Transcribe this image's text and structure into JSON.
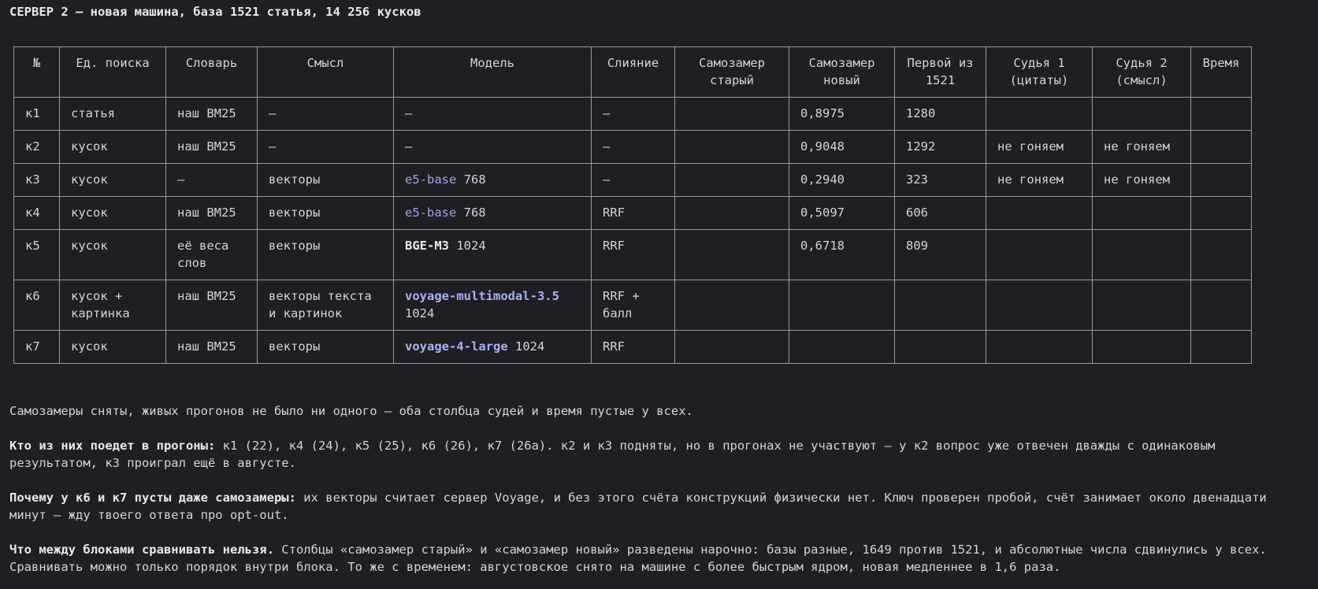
{
  "heading": "СЕРВЕР 2 — новая машина, база 1521 статья, 14 256 кусков",
  "table": {
    "headers": {
      "num": "№",
      "unit": "Ед. поиска",
      "dict": "Словарь",
      "sense": "Смысл",
      "model": "Модель",
      "fusion": "Слияние",
      "self_old": "Самозамер старый",
      "self_new": "Самозамер новый",
      "first": "Первой из 1521",
      "judge1": "Судья 1 (цитаты)",
      "judge2": "Судья 2 (смысл)",
      "time": "Время"
    },
    "rows": [
      {
        "num": "к1",
        "unit": "статья",
        "dict": "наш BM25",
        "sense": "—",
        "model_name": "—",
        "model_dim": "",
        "fusion": "—",
        "self_old": "",
        "self_new": "0,8975",
        "first": "1280",
        "judge1": "",
        "judge2": "",
        "time": ""
      },
      {
        "num": "к2",
        "unit": "кусок",
        "dict": "наш BM25",
        "sense": "—",
        "model_name": "—",
        "model_dim": "",
        "fusion": "—",
        "self_old": "",
        "self_new": "0,9048",
        "first": "1292",
        "judge1": "не гоняем",
        "judge2": "не гоняем",
        "time": ""
      },
      {
        "num": "к3",
        "unit": "кусок",
        "dict": "—",
        "sense": "векторы",
        "model_name": "e5-base",
        "model_dim": "768",
        "fusion": "—",
        "self_old": "",
        "self_new": "0,2940",
        "first": "323",
        "judge1": "не гоняем",
        "judge2": "не гоняем",
        "time": ""
      },
      {
        "num": "к4",
        "unit": "кусок",
        "dict": "наш BM25",
        "sense": "векторы",
        "model_name": "e5-base",
        "model_dim": "768",
        "fusion": "RRF",
        "self_old": "",
        "self_new": "0,5097",
        "first": "606",
        "judge1": "",
        "judge2": "",
        "time": ""
      },
      {
        "num": "к5",
        "unit": "кусок",
        "dict": "её веса слов",
        "sense": "векторы",
        "model_name": "BGE-M3",
        "model_dim": "1024",
        "fusion": "RRF",
        "self_old": "",
        "self_new": "0,6718",
        "first": "809",
        "judge1": "",
        "judge2": "",
        "time": ""
      },
      {
        "num": "к6",
        "unit": "кусок + картинка",
        "dict": "наш BM25",
        "sense": "векторы текста и картинок",
        "model_name": "voyage-multimodal-3.5",
        "model_dim": "1024",
        "fusion": "RRF + балл",
        "self_old": "",
        "self_new": "",
        "first": "",
        "judge1": "",
        "judge2": "",
        "time": ""
      },
      {
        "num": "к7",
        "unit": "кусок",
        "dict": "наш BM25",
        "sense": "векторы",
        "model_name": "voyage-4-large",
        "model_dim": "1024",
        "fusion": "RRF",
        "self_old": "",
        "self_new": "",
        "first": "",
        "judge1": "",
        "judge2": "",
        "time": ""
      }
    ]
  },
  "notes": {
    "p1": "Самозамеры сняты, живых прогонов не было ни одного — оба столбца судей и время пустые у всех.",
    "p2_lead": "Кто из них поедет в прогоны:",
    "p2_text": " к1 (22), к4 (24), к5 (25), к6 (26), к7 (26а). к2 и к3 подняты, но в прогонах не участвуют — у к2 вопрос уже отвечен дважды с одинаковым результатом, к3 проиграл ещё в августе.",
    "p3_lead": "Почему у к6 и к7 пусты даже самозамеры:",
    "p3_text": " их векторы считает сервер Voyage, и без этого счёта конструкций физически нет. Ключ проверен пробой, счёт занимает около двенадцати минут — жду твоего ответа про opt-out.",
    "p4_lead": "Что между блоками сравнивать нельзя.",
    "p4_text": " Столбцы «самозамер старый» и «самозамер новый» разведены нарочно: базы разные, 1649 против 1521, и абсолютные числа сдвинулись у всех. Сравнивать можно только порядок внутри блока. То же с временем: августовское снято на машине с более быстрым ядром, новая медленнее в 1,6 раза."
  }
}
